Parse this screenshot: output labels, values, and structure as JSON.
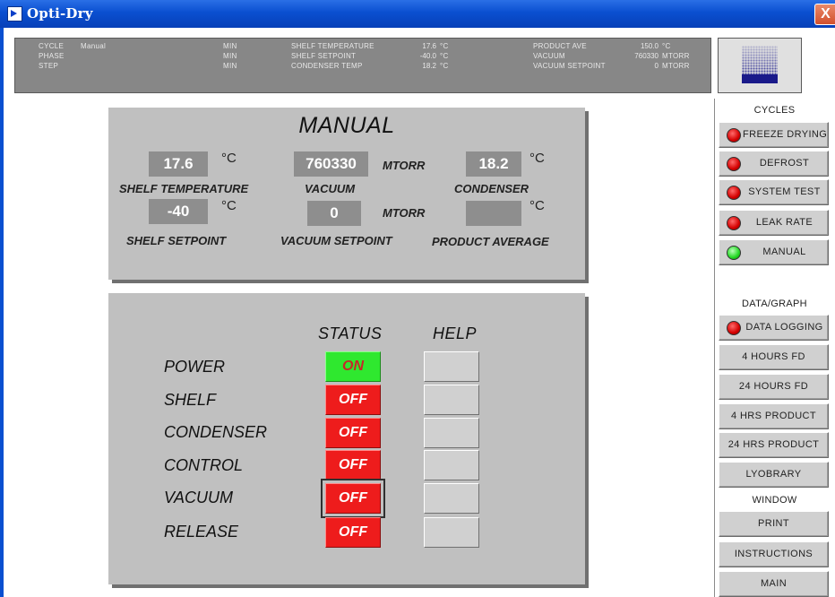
{
  "window": {
    "title": "Opti-Dry",
    "close_label": "X"
  },
  "statusbar": {
    "cycle_label": "CYCLE",
    "cycle_value": "Manual",
    "phase_label": "PHASE",
    "step_label": "STEP",
    "min1": "MIN",
    "min2": "MIN",
    "min3": "MIN",
    "shelf_temp_label": "SHELF TEMPERATURE",
    "shelf_temp_value": "17.6",
    "shelf_temp_unit": "°C",
    "shelf_setpoint_label": "SHELF SETPOINT",
    "shelf_setpoint_value": "-40.0",
    "shelf_setpoint_unit": "°C",
    "condenser_temp_label": "CONDENSER TEMP",
    "condenser_temp_value": "18.2",
    "condenser_temp_unit": "°C",
    "product_ave_label": "PRODUCT AVE",
    "product_ave_value": "150.0",
    "product_ave_unit": "°C",
    "vacuum_label": "VACUUM",
    "vacuum_value": "760330",
    "vacuum_unit": "MTORR",
    "vacuum_setpoint_label": "VACUUM SETPOINT",
    "vacuum_setpoint_value": "0",
    "vacuum_setpoint_unit": "MTORR"
  },
  "manual": {
    "title": "MANUAL",
    "shelf_temp": {
      "value": "17.6",
      "unit": "°C",
      "label": "SHELF TEMPERATURE"
    },
    "vacuum": {
      "value": "760330",
      "unit": "MTORR",
      "label": "VACUUM"
    },
    "condenser": {
      "value": "18.2",
      "unit": "°C",
      "label": "CONDENSER"
    },
    "shelf_setpoint": {
      "value": "-40",
      "unit": "°C",
      "label": "SHELF SETPOINT"
    },
    "vacuum_setpoint": {
      "value": "0",
      "unit": "MTORR",
      "label": "VACUUM SETPOINT"
    },
    "product_average": {
      "value": "",
      "unit": "°C",
      "label": "PRODUCT AVERAGE"
    }
  },
  "status_panel": {
    "status_header": "STATUS",
    "help_header": "HELP",
    "rows": [
      {
        "label": "POWER",
        "status": "ON"
      },
      {
        "label": "SHELF",
        "status": "OFF"
      },
      {
        "label": "CONDENSER",
        "status": "OFF"
      },
      {
        "label": "CONTROL",
        "status": "OFF"
      },
      {
        "label": "VACUUM",
        "status": "OFF"
      },
      {
        "label": "RELEASE",
        "status": "OFF"
      }
    ]
  },
  "sidebar": {
    "cycles_header": "CYCLES",
    "cycles": [
      {
        "label": "FREEZE DRYING",
        "led": "red"
      },
      {
        "label": "DEFROST",
        "led": "red"
      },
      {
        "label": "SYSTEM TEST",
        "led": "red"
      },
      {
        "label": "LEAK RATE",
        "led": "red"
      },
      {
        "label": "MANUAL",
        "led": "green"
      }
    ],
    "data_header": "DATA/GRAPH",
    "data_logging": {
      "label": "DATA LOGGING",
      "led": "red"
    },
    "graphs": [
      "4 HOURS FD",
      "24 HOURS FD",
      "4 HRS PRODUCT",
      "24 HRS PRODUCT",
      "LYOBRARY"
    ],
    "window_header": "WINDOW",
    "window_buttons": [
      "PRINT",
      "INSTRUCTIONS",
      "MAIN"
    ]
  },
  "colors": {
    "on": "#2fe82f",
    "off": "#ee1c1c",
    "led_red": "#d40000",
    "led_green": "#22d822",
    "panel": "#c0c0c0",
    "titlebar": "#0a4fd0"
  }
}
